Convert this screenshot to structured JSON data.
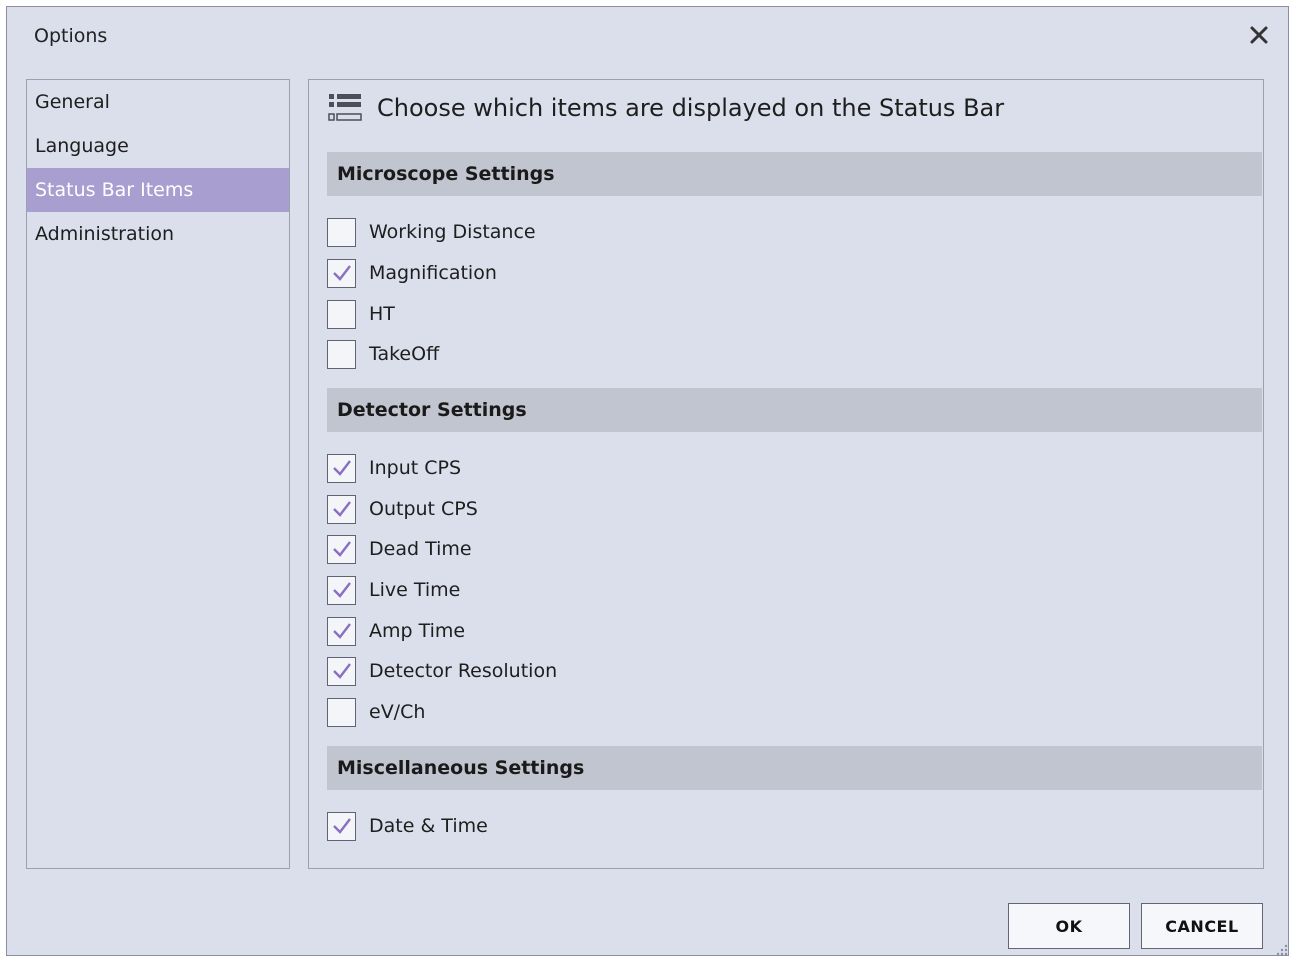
{
  "window": {
    "title": "Options"
  },
  "nav": {
    "items": [
      {
        "label": "General",
        "active": false
      },
      {
        "label": "Language",
        "active": false
      },
      {
        "label": "Status Bar Items",
        "active": true
      },
      {
        "label": "Administration",
        "active": false
      }
    ]
  },
  "panel": {
    "icon": "list-settings-icon",
    "header": "Choose which items are displayed on the Status Bar",
    "sections": [
      {
        "title": "Microscope Settings",
        "items": [
          {
            "label": "Working Distance",
            "checked": false
          },
          {
            "label": "Magnification",
            "checked": true
          },
          {
            "label": "HT",
            "checked": false
          },
          {
            "label": "TakeOff",
            "checked": false
          }
        ]
      },
      {
        "title": "Detector Settings",
        "items": [
          {
            "label": "Input CPS",
            "checked": true
          },
          {
            "label": "Output CPS",
            "checked": true
          },
          {
            "label": "Dead Time",
            "checked": true
          },
          {
            "label": "Live Time",
            "checked": true
          },
          {
            "label": "Amp Time",
            "checked": true
          },
          {
            "label": "Detector Resolution",
            "checked": true
          },
          {
            "label": "eV/Ch",
            "checked": false
          }
        ]
      },
      {
        "title": "Miscellaneous Settings",
        "items": [
          {
            "label": "Date & Time",
            "checked": true
          }
        ]
      }
    ]
  },
  "buttons": {
    "ok": "OK",
    "cancel": "CANCEL"
  },
  "colors": {
    "accent": "#a99ed0",
    "check": "#8a6fc2",
    "window_bg": "#dadfeb",
    "section_bg": "#c1c5d0"
  }
}
